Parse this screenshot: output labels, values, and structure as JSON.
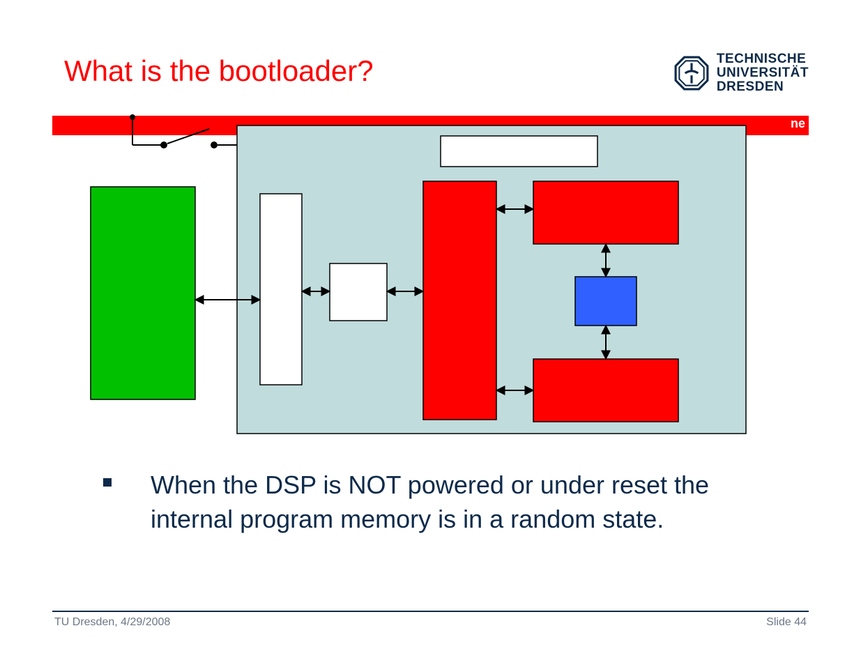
{
  "title": "What is the bootloader?",
  "logo": {
    "l1": "TECHNISCHE",
    "l2": "UNIVERSITÄT",
    "l3": "DRESDEN"
  },
  "vodafone_fragment": "ne",
  "bullet": "When the DSP is NOT powered or under reset the internal program memory is in a random state.",
  "footer_left": "TU Dresden, 4/29/2008",
  "footer_right": "Slide 44",
  "diagram": {
    "container_fill": "#c1dcdc",
    "blocks": {
      "green_external": "#00c000",
      "tall_white_1": "#ffffff",
      "small_white_center": "#ffffff",
      "wide_white_top": "#ffffff",
      "red_tall_center": "#ff0000",
      "red_top_right": "#ff0000",
      "red_bottom_right": "#ff0000",
      "blue_small_right": "#3060ff"
    }
  }
}
